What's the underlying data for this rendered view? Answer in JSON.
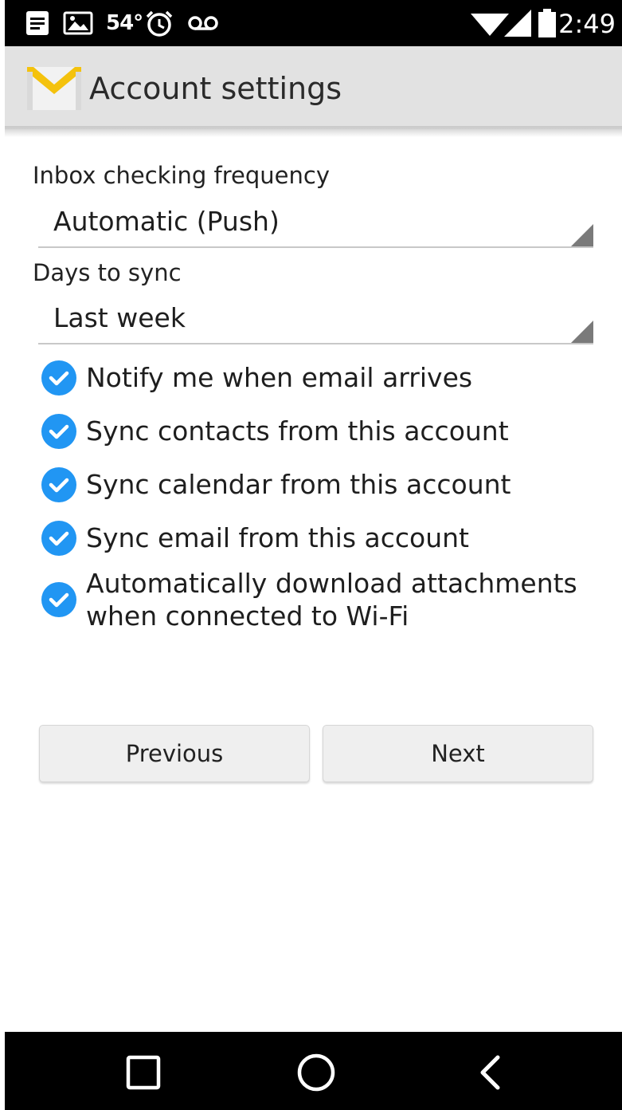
{
  "status_bar": {
    "icons": [
      "notes-icon",
      "image-icon",
      "alarm-icon",
      "voicemail-icon",
      "wifi-icon",
      "signal-icon",
      "battery-icon"
    ],
    "temperature": "54°",
    "time": "2:49"
  },
  "app_bar": {
    "logo": "gmail-envelope-icon",
    "title": "Account settings"
  },
  "form": {
    "inbox_frequency": {
      "label": "Inbox checking frequency",
      "value": "Automatic (Push)"
    },
    "days_to_sync": {
      "label": "Days to sync",
      "value": "Last week"
    },
    "checkboxes": [
      {
        "label": "Notify me when email arrives",
        "checked": true
      },
      {
        "label": "Sync contacts from this account",
        "checked": true
      },
      {
        "label": "Sync calendar from this account",
        "checked": true
      },
      {
        "label": "Sync email from this account",
        "checked": true
      },
      {
        "label_line1": "Automatically download attachments",
        "label_line2": "when connected to Wi-Fi",
        "checked": true
      }
    ]
  },
  "buttons": {
    "previous": "Previous",
    "next": "Next"
  },
  "nav_bar": {
    "icons": [
      "recents-icon",
      "home-icon",
      "back-icon"
    ]
  },
  "colors": {
    "accent": "#2196f3",
    "app_bar": "#e2e2e2",
    "gmail_yellow": "#f4c20d"
  }
}
